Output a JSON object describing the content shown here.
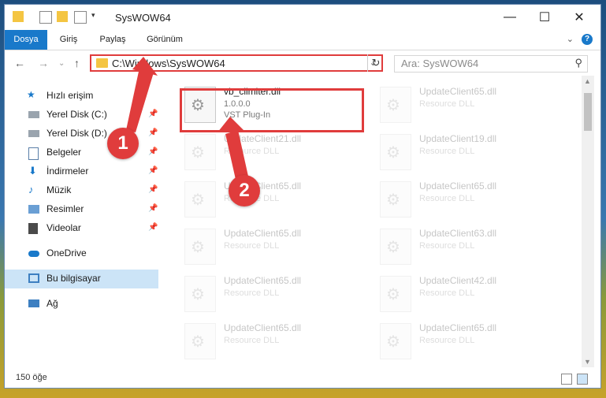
{
  "window": {
    "title": "SysWOW64"
  },
  "ribbon": {
    "tabs": [
      "Dosya",
      "Giriş",
      "Paylaş",
      "Görünüm"
    ],
    "help": "?"
  },
  "navigation": {
    "address": "C:\\Windows\\SysWOW64",
    "search_placeholder": "Ara: SysWOW64"
  },
  "sidebar": {
    "items": [
      {
        "label": "Hızlı erişim",
        "icon": "star-icon"
      },
      {
        "label": "Yerel Disk (C:)",
        "icon": "drive-icon"
      },
      {
        "label": "Yerel Disk (D:)",
        "icon": "drive-icon"
      },
      {
        "label": "Belgeler",
        "icon": "document-icon"
      },
      {
        "label": "İndirmeler",
        "icon": "download-icon"
      },
      {
        "label": "Müzik",
        "icon": "music-icon"
      },
      {
        "label": "Resimler",
        "icon": "pictures-icon"
      },
      {
        "label": "Videolar",
        "icon": "video-icon"
      },
      {
        "label": "OneDrive",
        "icon": "cloud-icon"
      },
      {
        "label": "Bu bilgisayar",
        "icon": "computer-icon"
      },
      {
        "label": "Ağ",
        "icon": "network-icon"
      }
    ]
  },
  "files": [
    {
      "name": "vb_climiter.dll",
      "version": "1.0.0.0",
      "desc": "VST Plug-In"
    },
    {
      "name": "UpdateClient65.dll",
      "version": "",
      "desc": "Resource DLL"
    },
    {
      "name": "UpdateClient21.dll",
      "version": "",
      "desc": "Resource DLL"
    },
    {
      "name": "UpdateClient19.dll",
      "version": "",
      "desc": "Resource DLL"
    },
    {
      "name": "UpdateClient65.dll",
      "version": "",
      "desc": "Resource DLL"
    },
    {
      "name": "UpdateClient65.dll",
      "version": "",
      "desc": "Resource DLL"
    },
    {
      "name": "UpdateClient65.dll",
      "version": "",
      "desc": "Resource DLL"
    },
    {
      "name": "UpdateClient63.dll",
      "version": "",
      "desc": "Resource DLL"
    },
    {
      "name": "UpdateClient65.dll",
      "version": "",
      "desc": "Resource DLL"
    },
    {
      "name": "UpdateClient42.dll",
      "version": "",
      "desc": "Resource DLL"
    },
    {
      "name": "UpdateClient65.dll",
      "version": "",
      "desc": "Resource DLL"
    },
    {
      "name": "UpdateClient65.dll",
      "version": "",
      "desc": "Resource DLL"
    }
  ],
  "status": {
    "count": "150 öğe"
  },
  "annotations": {
    "badge1": "1",
    "badge2": "2",
    "color": "#e03c3c"
  }
}
